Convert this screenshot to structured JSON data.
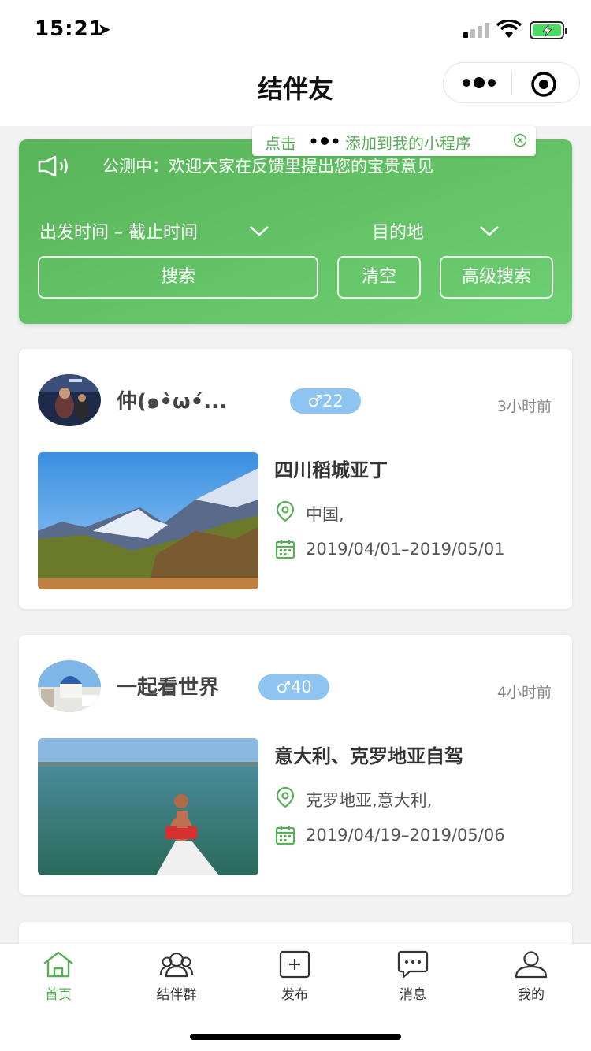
{
  "status_bar": {
    "time": "15:21"
  },
  "nav": {
    "title": "结伴友"
  },
  "tip": {
    "prefix": "点击",
    "suffix": "添加到我的小程序"
  },
  "notice": {
    "text": "公测中：欢迎大家在反馈里提出您的宝贵意见"
  },
  "filters": {
    "date_range": "出发时间 – 截止时间",
    "destination": "目的地"
  },
  "buttons": {
    "search": "搜索",
    "clear": "清空",
    "advanced": "高级搜索"
  },
  "posts": [
    {
      "username": "仲(๑•̀ω•́...",
      "gender_age": "♂22",
      "time_ago": "3小时前",
      "title": "四川稻城亚丁",
      "location": "中国,",
      "dates": "2019/04/01–2019/05/01"
    },
    {
      "username": "一起看世界",
      "gender_age": "♂40",
      "time_ago": "4小时前",
      "title": "意大利、克罗地亚自驾",
      "location": "克罗地亚,意大利,",
      "dates": "2019/04/19–2019/05/06"
    }
  ],
  "tabs": [
    {
      "label": "首页",
      "icon": "home-icon",
      "active": true
    },
    {
      "label": "结伴群",
      "icon": "group-icon",
      "active": false
    },
    {
      "label": "发布",
      "icon": "publish-icon",
      "active": false
    },
    {
      "label": "消息",
      "icon": "message-icon",
      "active": false
    },
    {
      "label": "我的",
      "icon": "profile-icon",
      "active": false
    }
  ],
  "colors": {
    "accent": "#5aae58",
    "badge": "#8ec4f2",
    "panel_start": "#58b458",
    "panel_end": "#6dd072"
  }
}
